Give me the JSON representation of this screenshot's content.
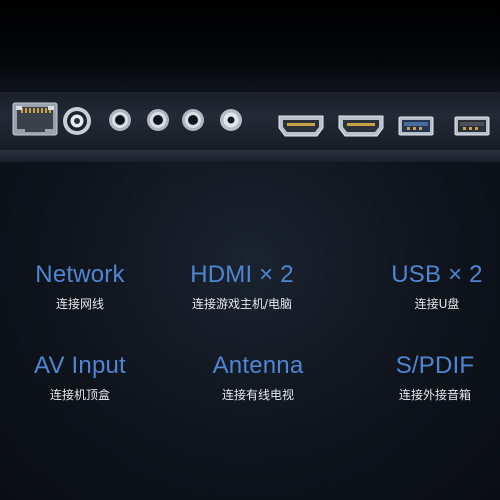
{
  "ports": [
    {
      "icon": "ethernet-port-icon"
    },
    {
      "icon": "antenna-port-icon"
    },
    {
      "icon": "av-jack-icon"
    },
    {
      "icon": "av-jack-icon"
    },
    {
      "icon": "av-jack-icon"
    },
    {
      "icon": "spdif-port-icon"
    },
    {
      "icon": "hdmi-port-icon"
    },
    {
      "icon": "hdmi-port-icon"
    },
    {
      "icon": "usb-port-icon"
    },
    {
      "icon": "usb-port-icon"
    }
  ],
  "features": [
    {
      "title": "Network",
      "subtitle": "连接网线"
    },
    {
      "title": "HDMI × 2",
      "subtitle": "连接游戏主机/电脑"
    },
    {
      "title": "USB × 2",
      "subtitle": "连接U盘"
    },
    {
      "title": "AV Input",
      "subtitle": "连接机顶盒"
    },
    {
      "title": "Antenna",
      "subtitle": "连接有线电视"
    },
    {
      "title": "S/PDIF",
      "subtitle": "连接外接音箱"
    }
  ],
  "colors": {
    "accent": "#4f86d4",
    "background": "#0b0f16",
    "subtitle": "#e6e9ee"
  }
}
